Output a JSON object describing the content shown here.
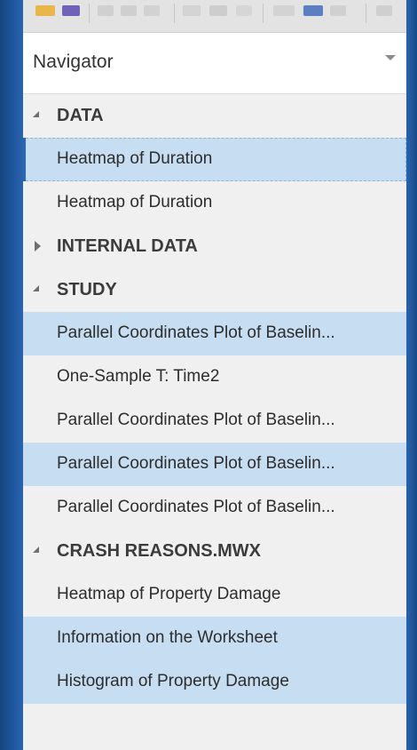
{
  "navigator": {
    "title": "Navigator"
  },
  "groups": [
    {
      "label": "DATA",
      "expanded": true,
      "items": [
        {
          "label": "Heatmap of Duration",
          "selected": true,
          "focused": true
        },
        {
          "label": "Heatmap of Duration",
          "selected": false
        }
      ]
    },
    {
      "label": "INTERNAL DATA",
      "expanded": false,
      "items": []
    },
    {
      "label": "STUDY",
      "expanded": true,
      "items": [
        {
          "label": "Parallel Coordinates Plot of Baselin...",
          "selected": true
        },
        {
          "label": "One-Sample T: Time2",
          "selected": false
        },
        {
          "label": "Parallel Coordinates Plot of Baselin...",
          "selected": false
        },
        {
          "label": "Parallel Coordinates Plot of Baselin...",
          "selected": true
        },
        {
          "label": "Parallel Coordinates Plot of Baselin...",
          "selected": false
        }
      ]
    },
    {
      "label": "CRASH REASONS.MWX",
      "expanded": true,
      "items": [
        {
          "label": "Heatmap of Property Damage",
          "selected": false
        },
        {
          "label": "Information on the Worksheet",
          "selected": true
        },
        {
          "label": "Histogram of Property Damage",
          "selected": true
        }
      ]
    }
  ],
  "colors": {
    "selection": "#c7ddf1",
    "focus_border": "#2a68b5",
    "window_frame": "#1d4d8c"
  }
}
